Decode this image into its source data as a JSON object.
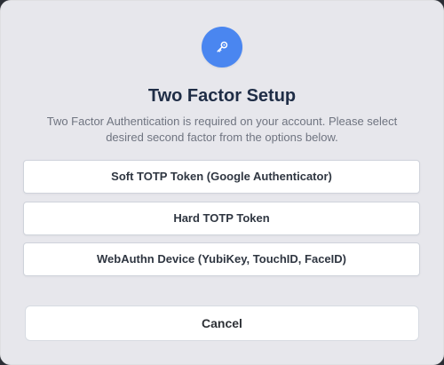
{
  "modal": {
    "icon": "key-icon",
    "title": "Two Factor Setup",
    "description": "Two Factor Authentication is required on your account. Please select desired second factor from the options below.",
    "options": [
      {
        "label": "Soft TOTP Token (Google Authenticator)"
      },
      {
        "label": "Hard TOTP Token"
      },
      {
        "label": "WebAuthn Device (YubiKey, TouchID, FaceID)"
      }
    ],
    "cancel_label": "Cancel"
  },
  "colors": {
    "accent": "#4a86f0",
    "title": "#1f2d46",
    "text": "#6f7480",
    "surface": "#e7e7ec",
    "button": "#ffffff"
  }
}
